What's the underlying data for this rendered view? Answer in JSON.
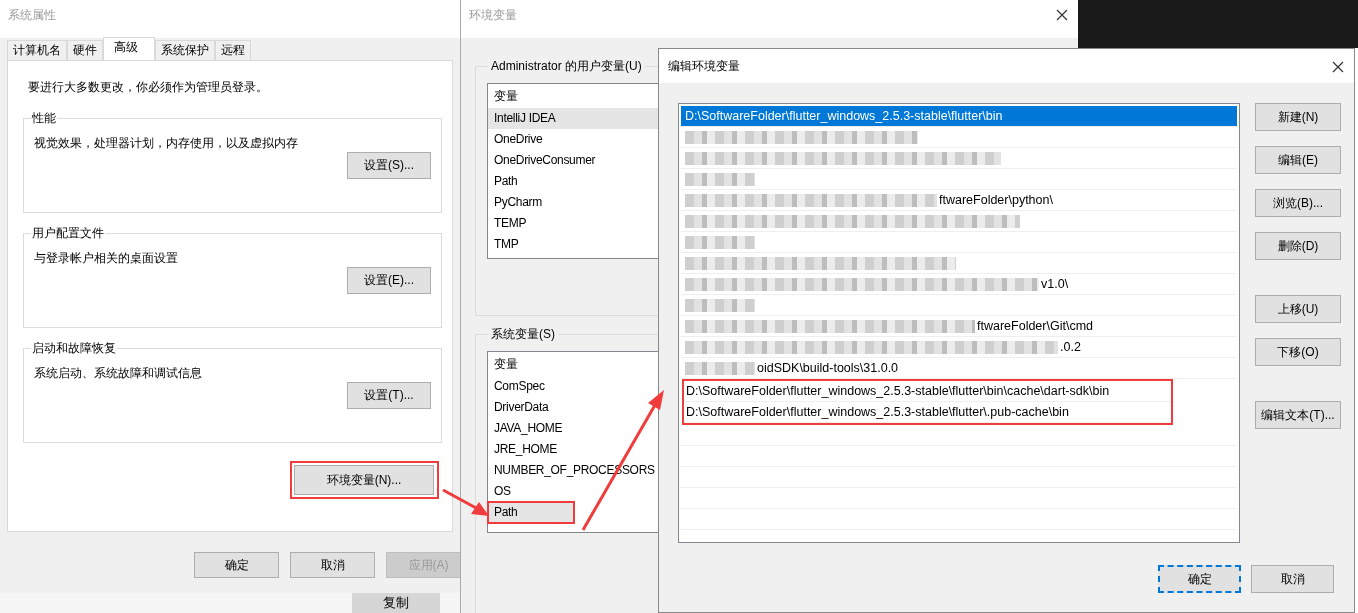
{
  "system_properties": {
    "title": "系统属性",
    "tabs": [
      {
        "label": "计算机名",
        "selected": false
      },
      {
        "label": "硬件",
        "selected": false
      },
      {
        "label": "高级",
        "selected": true
      },
      {
        "label": "系统保护",
        "selected": false
      },
      {
        "label": "远程",
        "selected": false
      }
    ],
    "admin_note": "要进行大多数更改，你必须作为管理员登录。",
    "groups": [
      {
        "title": "性能",
        "description": "视觉效果，处理器计划，内存使用，以及虚拟内存",
        "button": "设置(S)..."
      },
      {
        "title": "用户配置文件",
        "description": "与登录帐户相关的桌面设置",
        "button": "设置(E)..."
      },
      {
        "title": "启动和故障恢复",
        "description": "系统启动、系统故障和调试信息",
        "button": "设置(T)..."
      }
    ],
    "env_button": {
      "label": "环境变量(N)...",
      "highlighted": true
    },
    "buttons": [
      {
        "label": "确定",
        "disabled": false
      },
      {
        "label": "取消",
        "disabled": false
      },
      {
        "label": "应用(A)",
        "disabled": true
      }
    ]
  },
  "background": {
    "copy_button": "复制"
  },
  "env_vars": {
    "title": "环境变量",
    "user_group": {
      "title": "Administrator 的用户变量(U)",
      "column": "变量",
      "rows": [
        {
          "name": "IntelliJ IDEA",
          "selected": true,
          "highlighted": false
        },
        {
          "name": "OneDrive",
          "selected": false,
          "highlighted": false
        },
        {
          "name": "OneDriveConsumer",
          "selected": false,
          "highlighted": false
        },
        {
          "name": "Path",
          "selected": false,
          "highlighted": false
        },
        {
          "name": "PyCharm",
          "selected": false,
          "highlighted": false
        },
        {
          "name": "TEMP",
          "selected": false,
          "highlighted": false
        },
        {
          "name": "TMP",
          "selected": false,
          "highlighted": false
        }
      ]
    },
    "system_group": {
      "title": "系统变量(S)",
      "column": "变量",
      "rows": [
        {
          "name": "ComSpec",
          "selected": false,
          "highlighted": false
        },
        {
          "name": "DriverData",
          "selected": false,
          "highlighted": false
        },
        {
          "name": "JAVA_HOME",
          "selected": false,
          "highlighted": false
        },
        {
          "name": "JRE_HOME",
          "selected": false,
          "highlighted": false
        },
        {
          "name": "NUMBER_OF_PROCESSORS",
          "selected": false,
          "highlighted": false
        },
        {
          "name": "OS",
          "selected": false,
          "highlighted": false
        },
        {
          "name": "Path",
          "selected": true,
          "highlighted": true
        }
      ]
    }
  },
  "edit_dialog": {
    "title": "编辑环境变量",
    "entries": [
      {
        "text": "D:\\SoftwareFolder\\flutter_windows_2.5.3-stable\\flutter\\bin",
        "blurred": false,
        "selected": true,
        "highlighted": false
      },
      {
        "blurred": true,
        "selected": false,
        "highlighted": false
      },
      {
        "blurred": true,
        "selected": false,
        "highlighted": false
      },
      {
        "blurred": true,
        "selected": false,
        "highlighted": false
      },
      {
        "text": "ftwareFolder\\python\\",
        "blurred": true,
        "selected": false,
        "highlighted": false
      },
      {
        "blurred": true,
        "selected": false,
        "highlighted": false
      },
      {
        "blurred": true,
        "selected": false,
        "highlighted": false
      },
      {
        "blurred": true,
        "selected": false,
        "highlighted": false
      },
      {
        "text": "v1.0\\",
        "blurred": true,
        "selected": false,
        "highlighted": false
      },
      {
        "blurred": true,
        "selected": false,
        "highlighted": false
      },
      {
        "text": "ftwareFolder\\Git\\cmd",
        "blurred": true,
        "selected": false,
        "highlighted": false
      },
      {
        "text": ".0.2",
        "blurred": true,
        "selected": false,
        "highlighted": false
      },
      {
        "text": "oidSDK\\build-tools\\31.0.0",
        "blurred": true,
        "selected": false,
        "highlighted": false
      },
      {
        "text": "D:\\SoftwareFolder\\flutter_windows_2.5.3-stable\\flutter\\bin\\cache\\dart-sdk\\bin",
        "blurred": false,
        "selected": false,
        "highlighted": true
      },
      {
        "text": "D:\\SoftwareFolder\\flutter_windows_2.5.3-stable\\flutter\\.pub-cache\\bin",
        "blurred": false,
        "selected": false,
        "highlighted": true
      }
    ],
    "side_button_groups": [
      [
        "新建(N)",
        "编辑(E)",
        "浏览(B)...",
        "删除(D)"
      ],
      [
        "上移(U)",
        "下移(O)"
      ],
      [
        "编辑文本(T)..."
      ]
    ],
    "buttons": [
      "确定",
      "取消"
    ]
  }
}
